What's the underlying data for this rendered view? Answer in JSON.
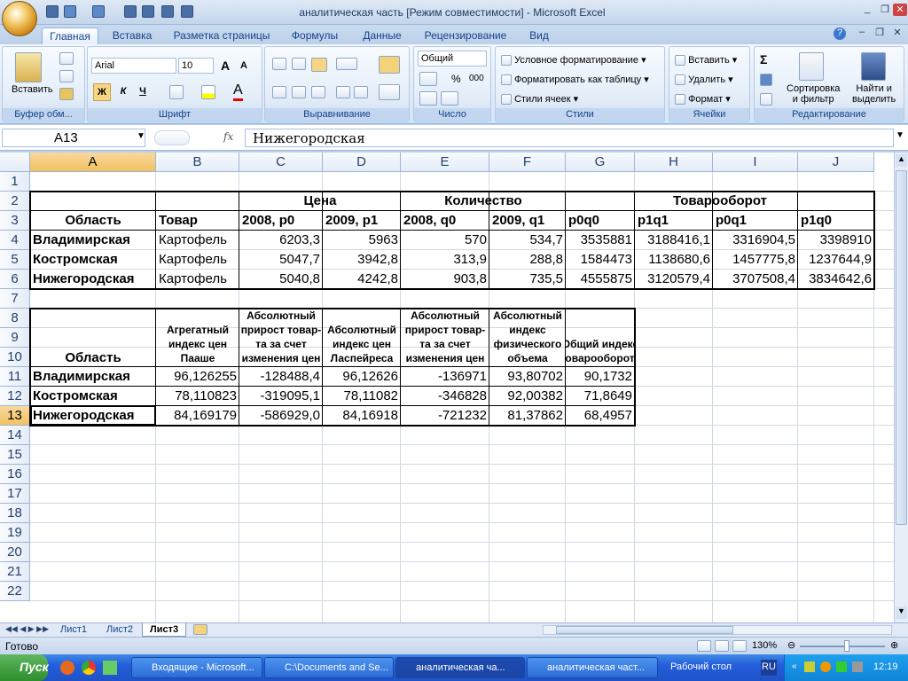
{
  "window": {
    "title": "аналитическая часть  [Режим совместимости] - Microsoft Excel",
    "office_button": "Готово"
  },
  "office_button_label": "Готово",
  "ribbon": {
    "tabs": [
      "Главная",
      "Вставка",
      "Разметка страницы",
      "Формулы",
      "Данные",
      "Рецензирование",
      "Вид"
    ],
    "active_tab": "Главная",
    "groups": {
      "clipboard": {
        "label": "Буфер обм...",
        "paste": "Вставить"
      },
      "font": {
        "label": "Шрифт",
        "font_name": "Arial",
        "font_size": "10",
        "bold": "Ж",
        "italic": "К",
        "underline": "Ч"
      },
      "alignment": {
        "label": "Выравнивание"
      },
      "number": {
        "label": "Число",
        "format": "Общий"
      },
      "styles": {
        "label": "Стили",
        "conditional": "Условное форматирование",
        "format_table": "Форматировать как таблицу",
        "cell_styles": "Стили ячеек"
      },
      "cells": {
        "label": "Ячейки",
        "insert": "Вставить",
        "delete": "Удалить",
        "format": "Формат"
      },
      "editing": {
        "label": "Редактирование",
        "sort": "Сортировка\nи фильтр",
        "find": "Найти и\nвыделить"
      }
    }
  },
  "formula_bar": {
    "name_box": "A13",
    "fx": "fx",
    "formula": "Нижегородская"
  },
  "columns": [
    "A",
    "B",
    "C",
    "D",
    "E",
    "F",
    "G",
    "H",
    "I",
    "J"
  ],
  "rows": [
    "1",
    "2",
    "3",
    "4",
    "5",
    "6",
    "7",
    "8",
    "9",
    "10",
    "11",
    "12",
    "13",
    "14",
    "15",
    "16",
    "17",
    "18",
    "19",
    "20",
    "21",
    "22"
  ],
  "table1": {
    "headers": {
      "price": "Цена",
      "qty": "Количество",
      "turnover": "Товарооборот"
    },
    "subheaders": [
      "Область",
      "Товар",
      "2008,  p0",
      "2009,   p1",
      "2008,   q0",
      "2009,   q1",
      "p0q0",
      "p1q1",
      "p0q1",
      "p1q0"
    ],
    "data": [
      [
        "Владимирская",
        "Картофель",
        "6203,3",
        "5963",
        "570",
        "534,7",
        "3535881",
        "3188416,1",
        "3316904,5",
        "3398910"
      ],
      [
        "Костромская",
        "Картофель",
        "5047,7",
        "3942,8",
        "313,9",
        "288,8",
        "1584473",
        "1138680,6",
        "1457775,8",
        "1237644,9"
      ],
      [
        "Нижегородская",
        "Картофель",
        "5040,8",
        "4242,8",
        "903,8",
        "735,5",
        "4555875",
        "3120579,4",
        "3707508,4",
        "3834642,6"
      ]
    ]
  },
  "table2": {
    "headers": [
      "Область",
      "Агрегатный индекс цен Пааше",
      "Абсолютный прирост товар-та за счет изменения цен",
      "Абсолютный индекс цен Ласпейреса",
      "Абсолютный прирост товар-та за счет изменения цен",
      "Абсолютный индекс физического объема",
      "Общий индекс товарооборота"
    ],
    "data": [
      [
        "Владимирская",
        "96,126255",
        "-128488,4",
        "96,12626",
        "-136971",
        "93,80702",
        "90,1732"
      ],
      [
        "Костромская",
        "78,110823",
        "-319095,1",
        "78,11082",
        "-346828",
        "92,00382",
        "71,8649"
      ],
      [
        "Нижегородская",
        "84,169179",
        "-586929,0",
        "84,16918",
        "-721232",
        "81,37862",
        "68,4957"
      ]
    ]
  },
  "sheets": [
    "Лист1",
    "Лист2",
    "Лист3"
  ],
  "active_sheet": "Лист3",
  "status": {
    "ready": "Готово",
    "zoom": "130%"
  },
  "taskbar": {
    "start": "Пуск",
    "tasks": [
      "Входящие - Microsoft...",
      "C:\\Documents and Se...",
      "аналитическая ча...",
      "аналитическая част..."
    ],
    "desktop": "Рабочий стол",
    "lang": "RU",
    "time": "12:19"
  }
}
